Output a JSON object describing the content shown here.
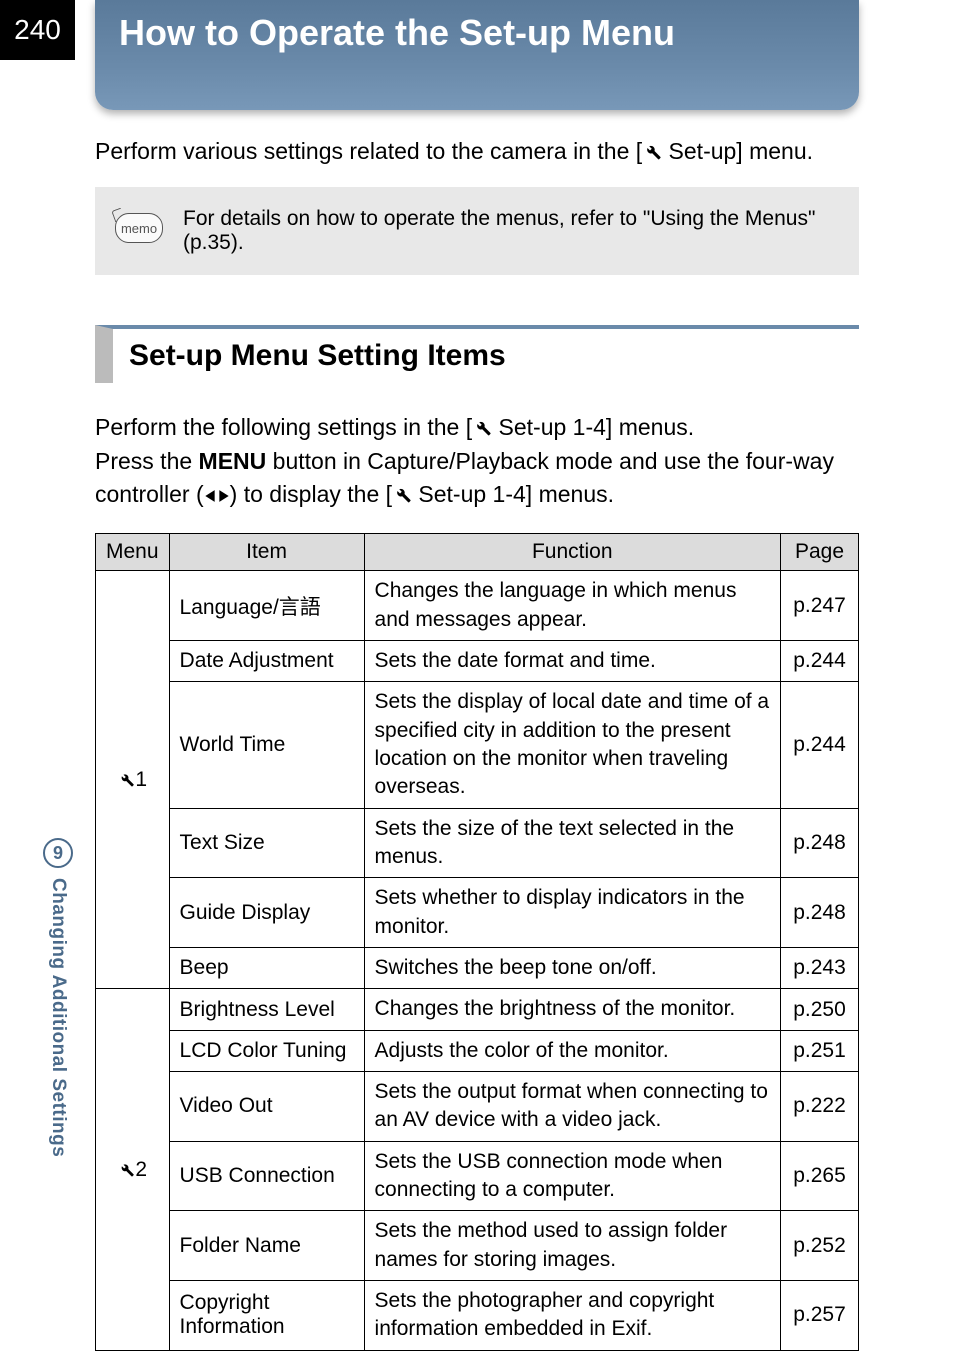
{
  "page_number": "240",
  "title": "How to Operate the Set-up Menu",
  "intro_prefix": "Perform various settings related to the camera in the [",
  "intro_suffix": " Set-up] menu.",
  "memo_label": "memo",
  "memo_text": "For details on how to operate the menus, refer to \"Using the Menus\" (p.35).",
  "section_heading": "Set-up Menu Setting Items",
  "instruction_line1_prefix": "Perform the following settings in the [",
  "instruction_line1_suffix": " Set-up 1-4] menus.",
  "instruction_line2_a": "Press the ",
  "instruction_menu_key": "MENU",
  "instruction_line2_b": " button in Capture/Playback mode and use the four-way controller (",
  "instruction_line2_c": ") to display the [",
  "instruction_line2_d": " Set-up 1-4] menus.",
  "table": {
    "headers": {
      "menu": "Menu",
      "item": "Item",
      "function": "Function",
      "page": "Page"
    },
    "groups": [
      {
        "menu_suffix": "1",
        "rows": [
          {
            "item": "Language/言語",
            "function": "Changes the language in which menus and messages appear.",
            "page": "p.247"
          },
          {
            "item": "Date Adjustment",
            "function": "Sets the date format and time.",
            "page": "p.244"
          },
          {
            "item": "World Time",
            "function": "Sets the display of local date and time of a specified city in addition to the present location on the monitor when traveling overseas.",
            "page": "p.244"
          },
          {
            "item": "Text Size",
            "function": "Sets the size of the text selected in the menus.",
            "page": "p.248"
          },
          {
            "item": "Guide Display",
            "function": "Sets whether to display indicators in the monitor.",
            "page": "p.248"
          },
          {
            "item": "Beep",
            "function": "Switches the beep tone on/off.",
            "page": "p.243"
          }
        ]
      },
      {
        "menu_suffix": "2",
        "rows": [
          {
            "item": "Brightness Level",
            "function": "Changes the brightness of the monitor.",
            "page": "p.250"
          },
          {
            "item": "LCD Color Tuning",
            "function": "Adjusts the color of the monitor.",
            "page": "p.251"
          },
          {
            "item": "Video Out",
            "function": "Sets the output format when connecting to an AV device with a video jack.",
            "page": "p.222"
          },
          {
            "item": "USB Connection",
            "function": "Sets the USB connection mode when connecting to a computer.",
            "page": "p.265"
          },
          {
            "item": "Folder Name",
            "function": "Sets the method used to assign folder names for storing images.",
            "page": "p.252"
          },
          {
            "item": "Copyright Information",
            "function": "Sets the photographer and copyright information embedded in Exif.",
            "page": "p.257"
          }
        ]
      }
    ]
  },
  "side_tab": {
    "number": "9",
    "label": "Changing Additional Settings"
  }
}
